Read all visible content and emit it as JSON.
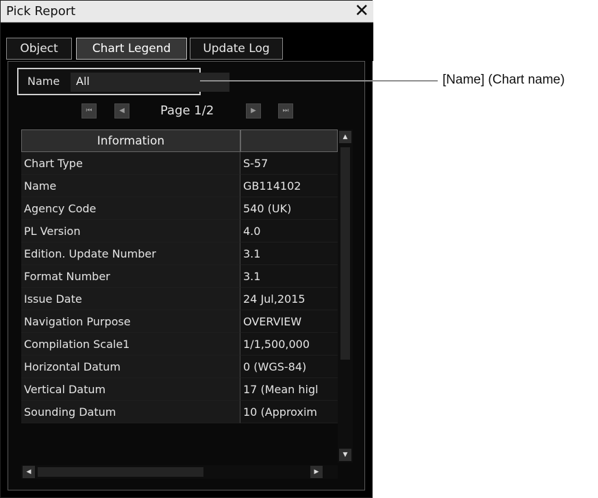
{
  "window": {
    "title": "Pick Report",
    "close_icon": "close-icon"
  },
  "tabs": [
    {
      "label": "Object",
      "active": false
    },
    {
      "label": "Chart Legend",
      "active": true
    },
    {
      "label": "Update Log",
      "active": false
    }
  ],
  "name_filter": {
    "label": "Name",
    "value": "All"
  },
  "pager": {
    "text": "Page 1/2",
    "first_icon": "first-page-icon",
    "prev_icon": "prev-page-icon",
    "next_icon": "next-page-icon",
    "last_icon": "last-page-icon"
  },
  "table": {
    "header": {
      "col1": "Information",
      "col2": ""
    },
    "rows": [
      {
        "info": "Chart Type",
        "value": "S-57"
      },
      {
        "info": "Name",
        "value": "GB114102"
      },
      {
        "info": "Agency Code",
        "value": "540 (UK)"
      },
      {
        "info": "PL Version",
        "value": "4.0"
      },
      {
        "info": "Edition. Update Number",
        "value": "3.1"
      },
      {
        "info": "Format Number",
        "value": "3.1"
      },
      {
        "info": "Issue Date",
        "value": "24 Jul,2015"
      },
      {
        "info": "Navigation Purpose",
        "value": "OVERVIEW"
      },
      {
        "info": "Compilation Scale1",
        "value": "1/1,500,000"
      },
      {
        "info": "Horizontal Datum",
        "value": "0 (WGS-84)"
      },
      {
        "info": "Vertical Datum",
        "value": "17 (Mean higl"
      },
      {
        "info": "Sounding Datum",
        "value": "10 (Approxim"
      }
    ]
  },
  "callout": {
    "text": "[Name] (Chart name)"
  },
  "colors": {
    "window_bg": "#000000",
    "titlebar_bg": "#e9e9e9",
    "callout_line": "#8f8f8f"
  }
}
